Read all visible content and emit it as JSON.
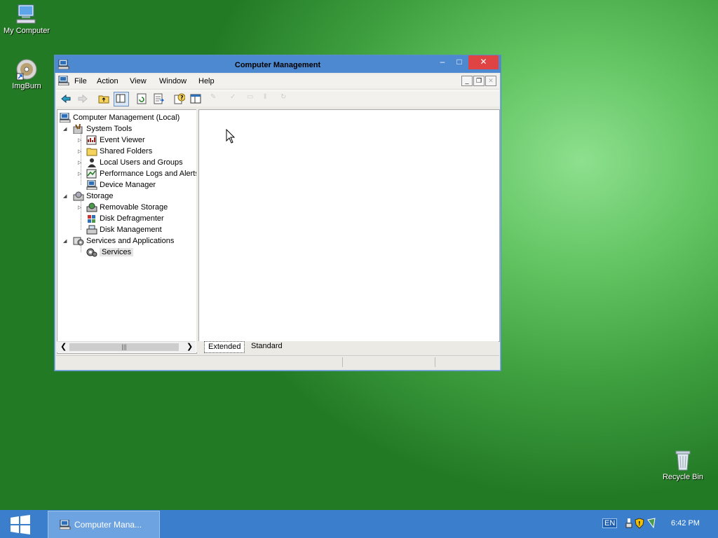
{
  "desktop": {
    "icons": [
      {
        "label": "My Computer",
        "icon": "my-computer-icon"
      },
      {
        "label": "ImgBurn",
        "icon": "imgburn-icon"
      },
      {
        "label": "Recycle Bin",
        "icon": "recycle-bin-icon"
      }
    ]
  },
  "window": {
    "title": "Computer Management",
    "menu": [
      "File",
      "Action",
      "View",
      "Window",
      "Help"
    ],
    "caption_buttons": {
      "minimize": "–",
      "maximize": "□",
      "close": "✕"
    }
  },
  "tree": {
    "root": "Computer Management (Local)",
    "groups": [
      {
        "label": "System Tools",
        "children": [
          "Event Viewer",
          "Shared Folders",
          "Local Users and Groups",
          "Performance Logs and Alerts",
          "Device Manager"
        ]
      },
      {
        "label": "Storage",
        "children": [
          "Removable Storage",
          "Disk Defragmenter",
          "Disk Management"
        ]
      },
      {
        "label": "Services and Applications",
        "children": [
          "Services"
        ]
      }
    ]
  },
  "tabs": [
    "Extended",
    "Standard"
  ],
  "taskbar": {
    "start_icon": "windows-logo-icon",
    "task_label": "Computer Mana...",
    "language": "EN",
    "time": "6:42 PM"
  },
  "colors": {
    "title_bar": "#4c89d0",
    "taskbar": "#3b7fcc",
    "close_button": "#e04343"
  }
}
